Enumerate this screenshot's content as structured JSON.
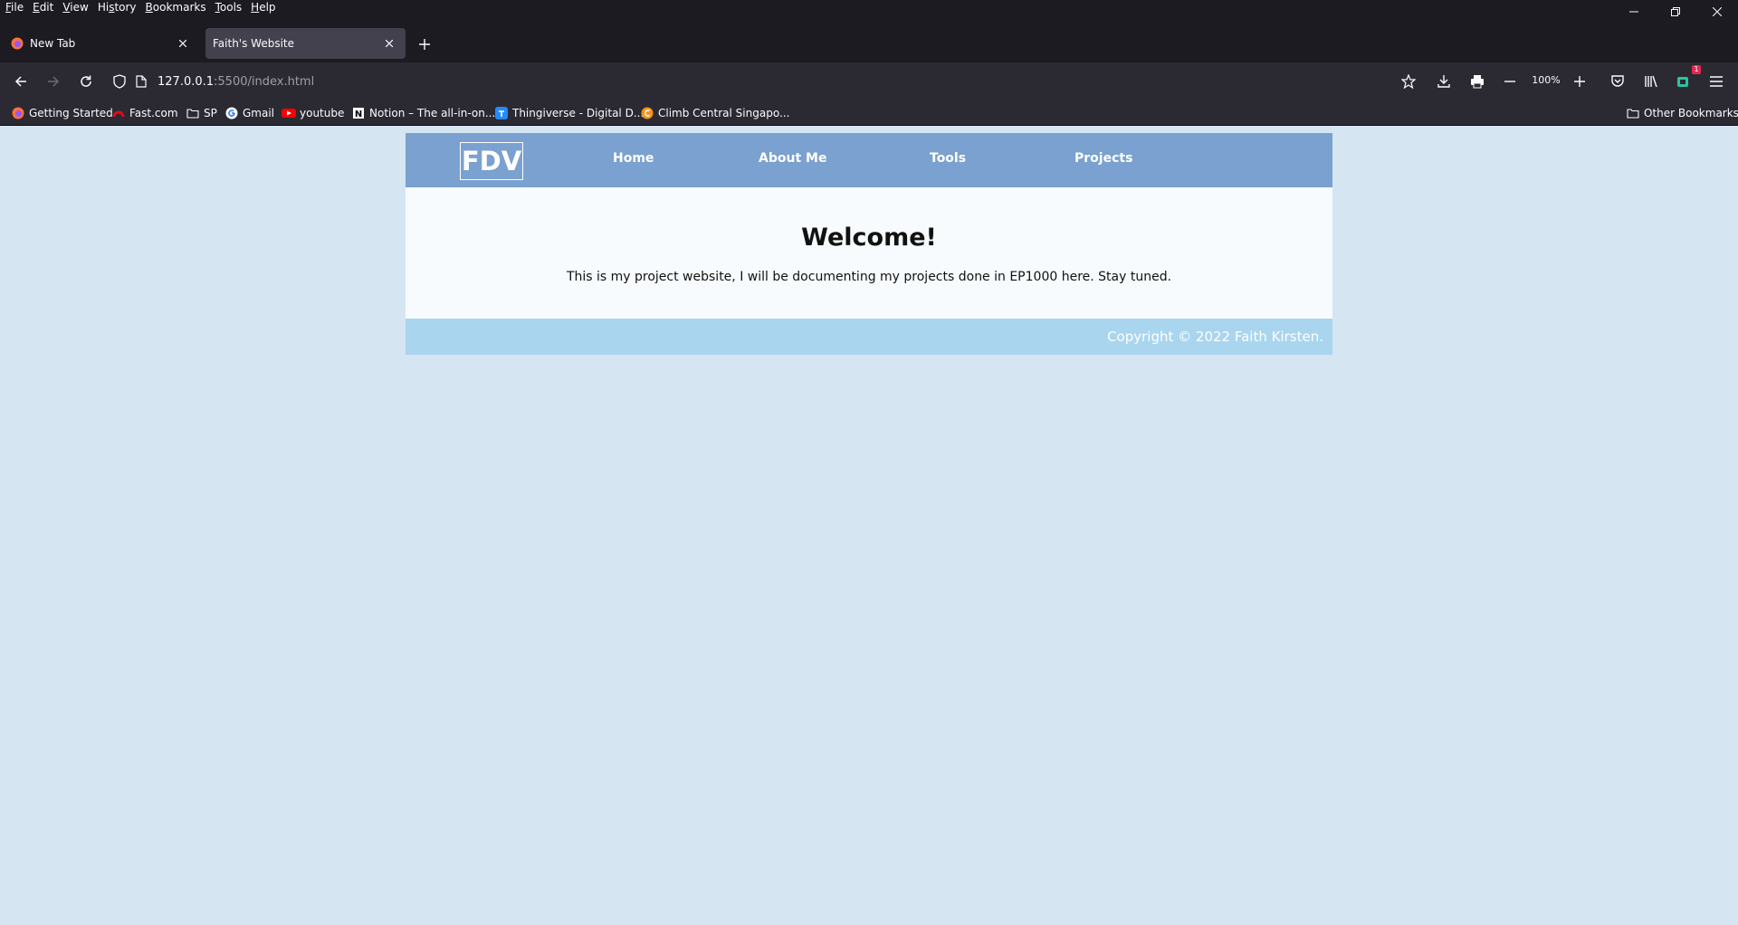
{
  "browser": {
    "menus": [
      {
        "label": "File",
        "accel": "F"
      },
      {
        "label": "Edit",
        "accel": "E"
      },
      {
        "label": "View",
        "accel": "V"
      },
      {
        "label": "History",
        "accel": "s"
      },
      {
        "label": "Bookmarks",
        "accel": "B"
      },
      {
        "label": "Tools",
        "accel": "T"
      },
      {
        "label": "Help",
        "accel": "H"
      }
    ],
    "tabs": [
      {
        "label": "New Tab",
        "active": false
      },
      {
        "label": "Faith's Website",
        "active": true
      }
    ],
    "url": {
      "host": "127.0.0.1",
      "rest": ":5500/index.html"
    },
    "zoom": "100%",
    "addon_badge": "1",
    "bookmarks": [
      {
        "label": "Getting Started",
        "icon": "firefox-icon"
      },
      {
        "label": "Fast.com",
        "icon": "speed-icon"
      },
      {
        "label": "SP",
        "icon": "folder-icon"
      },
      {
        "label": "Gmail",
        "icon": "google-icon"
      },
      {
        "label": "youtube",
        "icon": "youtube-icon"
      },
      {
        "label": "Notion – The all-in-on...",
        "icon": "notion-icon"
      },
      {
        "label": "Thingiverse - Digital D...",
        "icon": "thingiverse-icon"
      },
      {
        "label": "Climb Central Singapo...",
        "icon": "climb-icon"
      }
    ],
    "other_bookmarks": "Other Bookmarks"
  },
  "site": {
    "logo": "FDV",
    "nav": [
      "Home",
      "About Me",
      "Tools",
      "Projects"
    ],
    "heading": "Welcome!",
    "intro": "This is my project website, I will be documenting my projects done in EP1000 here. Stay tuned.",
    "footer": "Copyright © 2022 Faith Kirsten.",
    "colors": {
      "nav": "#7aa1cf",
      "main": "#f7fbfd",
      "footer": "#a9d5ef",
      "body": "#d6e5f2"
    }
  }
}
